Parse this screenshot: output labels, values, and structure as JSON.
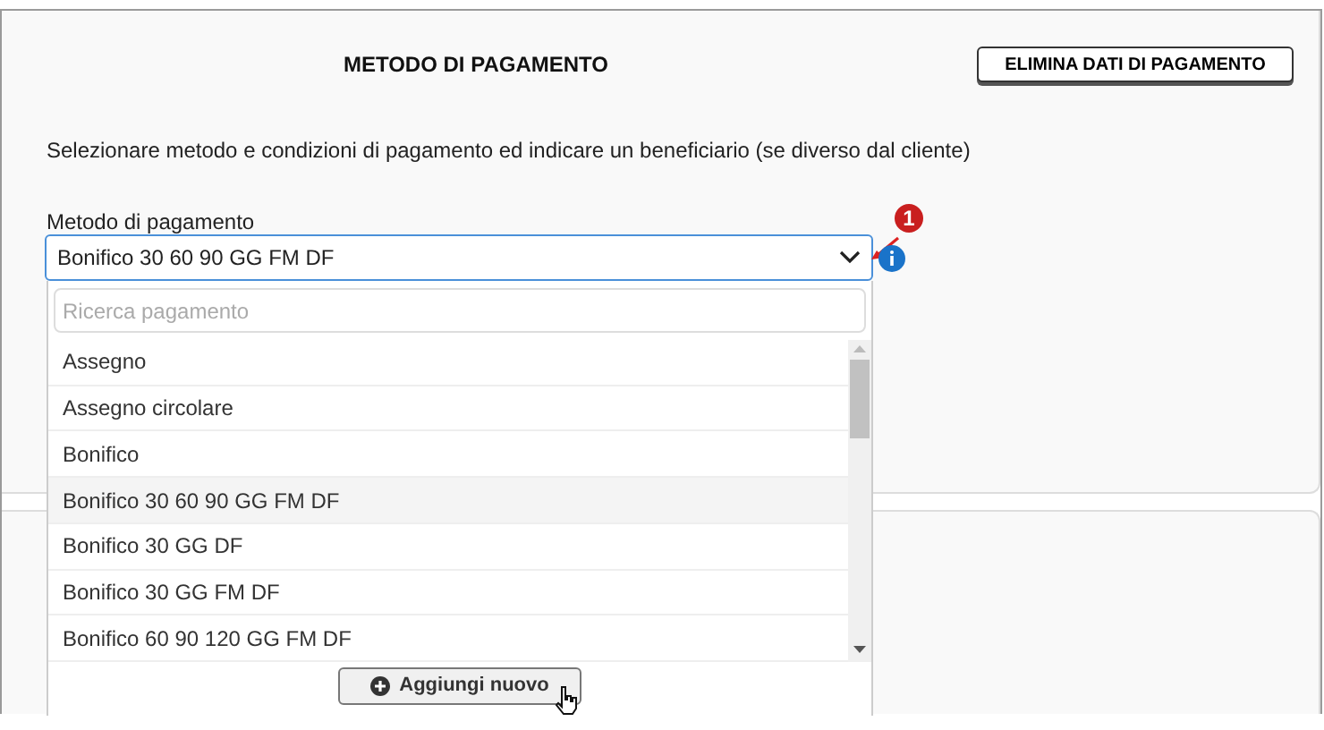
{
  "header": {
    "title": "METODO DI PAGAMENTO",
    "delete_button": "ELIMINA DATI DI PAGAMENTO"
  },
  "description": "Selezionare metodo e condizioni di pagamento ed indicare un beneficiario (se diverso dal cliente)",
  "payment_method": {
    "label": "Metodo di pagamento",
    "value": "Bonifico 30 60 90 GG FM DF",
    "expanded": true,
    "callout": "1"
  },
  "dropdown": {
    "search_placeholder": "Ricerca pagamento",
    "options": [
      {
        "label": "Assegno",
        "selected": false
      },
      {
        "label": "Assegno circolare",
        "selected": false
      },
      {
        "label": "Bonifico",
        "selected": false
      },
      {
        "label": "Bonifico 30 60 90 GG FM DF",
        "selected": true
      },
      {
        "label": "Bonifico 30 GG DF",
        "selected": false
      },
      {
        "label": "Bonifico 30 GG FM DF",
        "selected": false
      },
      {
        "label": "Bonifico 60 90 120 GG FM DF",
        "selected": false
      }
    ],
    "add_button": "Aggiungi nuovo"
  }
}
